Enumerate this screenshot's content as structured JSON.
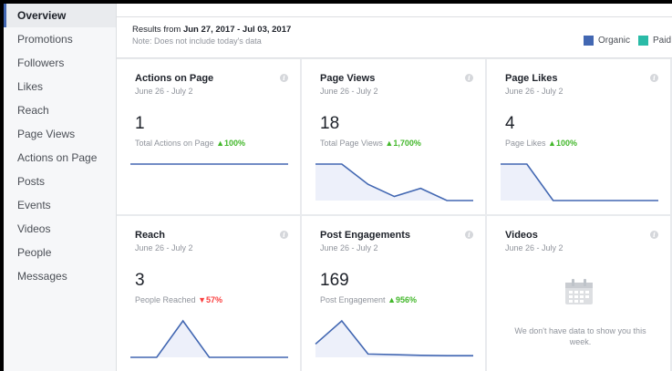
{
  "sidebar": {
    "items": [
      {
        "label": "Overview",
        "active": true
      },
      {
        "label": "Promotions"
      },
      {
        "label": "Followers"
      },
      {
        "label": "Likes"
      },
      {
        "label": "Reach"
      },
      {
        "label": "Page Views"
      },
      {
        "label": "Actions on Page"
      },
      {
        "label": "Posts"
      },
      {
        "label": "Events"
      },
      {
        "label": "Videos"
      },
      {
        "label": "People"
      },
      {
        "label": "Messages"
      }
    ]
  },
  "results": {
    "prefix": "Results from ",
    "range": "Jun 27, 2017 - Jul 03, 2017",
    "note": "Note: Does not include today's data"
  },
  "legend": {
    "organic": {
      "label": "Organic",
      "color": "#4267b2"
    },
    "paid": {
      "label": "Paid",
      "color": "#2abba7"
    }
  },
  "colors": {
    "line": "#4267b2",
    "fill": "#edf0fa",
    "up": "#42b72a",
    "down": "#fa3e3e"
  },
  "cards": [
    {
      "title": "Actions on Page",
      "range": "June 26 - July 2",
      "value": "1",
      "metric": "Total Actions on Page",
      "change_arrow": "▲",
      "change": "100%",
      "direction": "up",
      "spark": [
        1,
        1,
        1,
        1,
        1,
        1,
        1
      ],
      "spark_fill": false
    },
    {
      "title": "Page Views",
      "range": "June 26 - July 2",
      "value": "18",
      "metric": "Total Page Views",
      "change_arrow": "▲",
      "change": "1,700%",
      "direction": "up",
      "spark": [
        9,
        9,
        4,
        1,
        3,
        0,
        0
      ],
      "spark_fill": true
    },
    {
      "title": "Page Likes",
      "range": "June 26 - July 2",
      "value": "4",
      "metric": "Page Likes",
      "change_arrow": "▲",
      "change": "100%",
      "direction": "up",
      "spark": [
        4,
        4,
        0,
        0,
        0,
        0,
        0
      ],
      "spark_fill": true
    },
    {
      "title": "Reach",
      "range": "June 26 - July 2",
      "value": "3",
      "metric": "People Reached",
      "change_arrow": "▼",
      "change": "57%",
      "direction": "down",
      "spark": [
        0,
        0,
        3,
        0,
        0,
        0,
        0
      ],
      "spark_fill": true
    },
    {
      "title": "Post Engagements",
      "range": "June 26 - July 2",
      "value": "169",
      "metric": "Post Engagement",
      "change_arrow": "▲",
      "change": "956%",
      "direction": "up",
      "spark": [
        40,
        110,
        10,
        8,
        6,
        5,
        5
      ],
      "spark_fill": true
    },
    {
      "title": "Videos",
      "range": "June 26 - July 2",
      "empty_message": "We don't have data to show you this week."
    }
  ]
}
